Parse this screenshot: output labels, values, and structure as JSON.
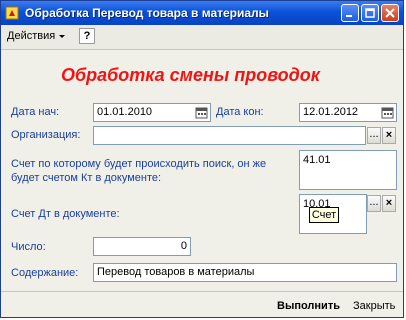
{
  "window": {
    "title": "Обработка  Перевод товара в материалы"
  },
  "toolbar": {
    "actions_label": "Действия",
    "help_label": "?"
  },
  "form": {
    "heading": "Обработка смены проводок",
    "date_start_label": "Дата нач:",
    "date_start_value": "01.01.2010",
    "date_end_label": "Дата кон:",
    "date_end_value": "12.01.2012",
    "organization_label": "Организация:",
    "organization_value": "",
    "search_account_label": "Счет по которому будет происходить поиск, он же будет счетом Кт в документе:",
    "search_account_value": "41.01",
    "debit_account_label": "Счет Дт в документе:",
    "debit_account_value": "10.01",
    "debit_account_tooltip": "Счет",
    "number_label": "Число:",
    "number_value": "0",
    "content_label": "Содержание:",
    "content_value": "Перевод товаров в материалы"
  },
  "buttons": {
    "select": "...",
    "clear": "×",
    "execute": "Выполнить",
    "close": "Закрыть"
  },
  "icons": {
    "app": "app-1c-icon",
    "calendar": "calendar-icon",
    "minimize": "minimize-icon",
    "maximize": "maximize-icon",
    "close": "close-icon"
  },
  "colors": {
    "heading": "#f11414",
    "labels": "#1a3f9c",
    "titlebar": "#0a52d8"
  }
}
